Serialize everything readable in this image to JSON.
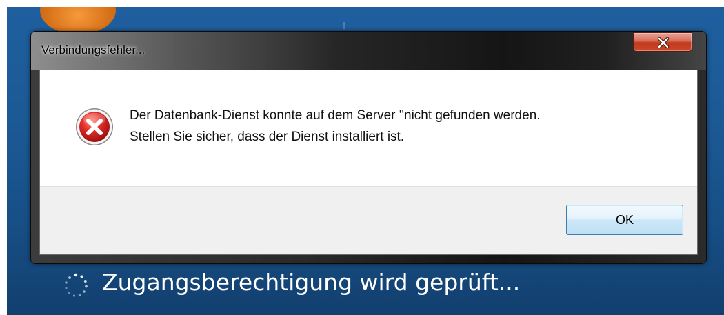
{
  "dialog": {
    "title": "Verbindungsfehler...",
    "close_icon": "close-icon",
    "icon": "error-icon",
    "message_lines": [
      "Der Datenbank-Dienst konnte auf dem Server ''nicht gefunden werden.",
      "Stellen Sie sicher, dass der Dienst installiert ist."
    ],
    "ok_label": "OK"
  },
  "login": {
    "status": "Zugangsberechtigung wird geprüft...",
    "icon": "loading-spinner-icon"
  },
  "colors": {
    "desktop_blue": "#1c5a96",
    "close_red": "#c2391c",
    "ok_border": "#3c7fb1",
    "error_red": "#d01c1c"
  }
}
